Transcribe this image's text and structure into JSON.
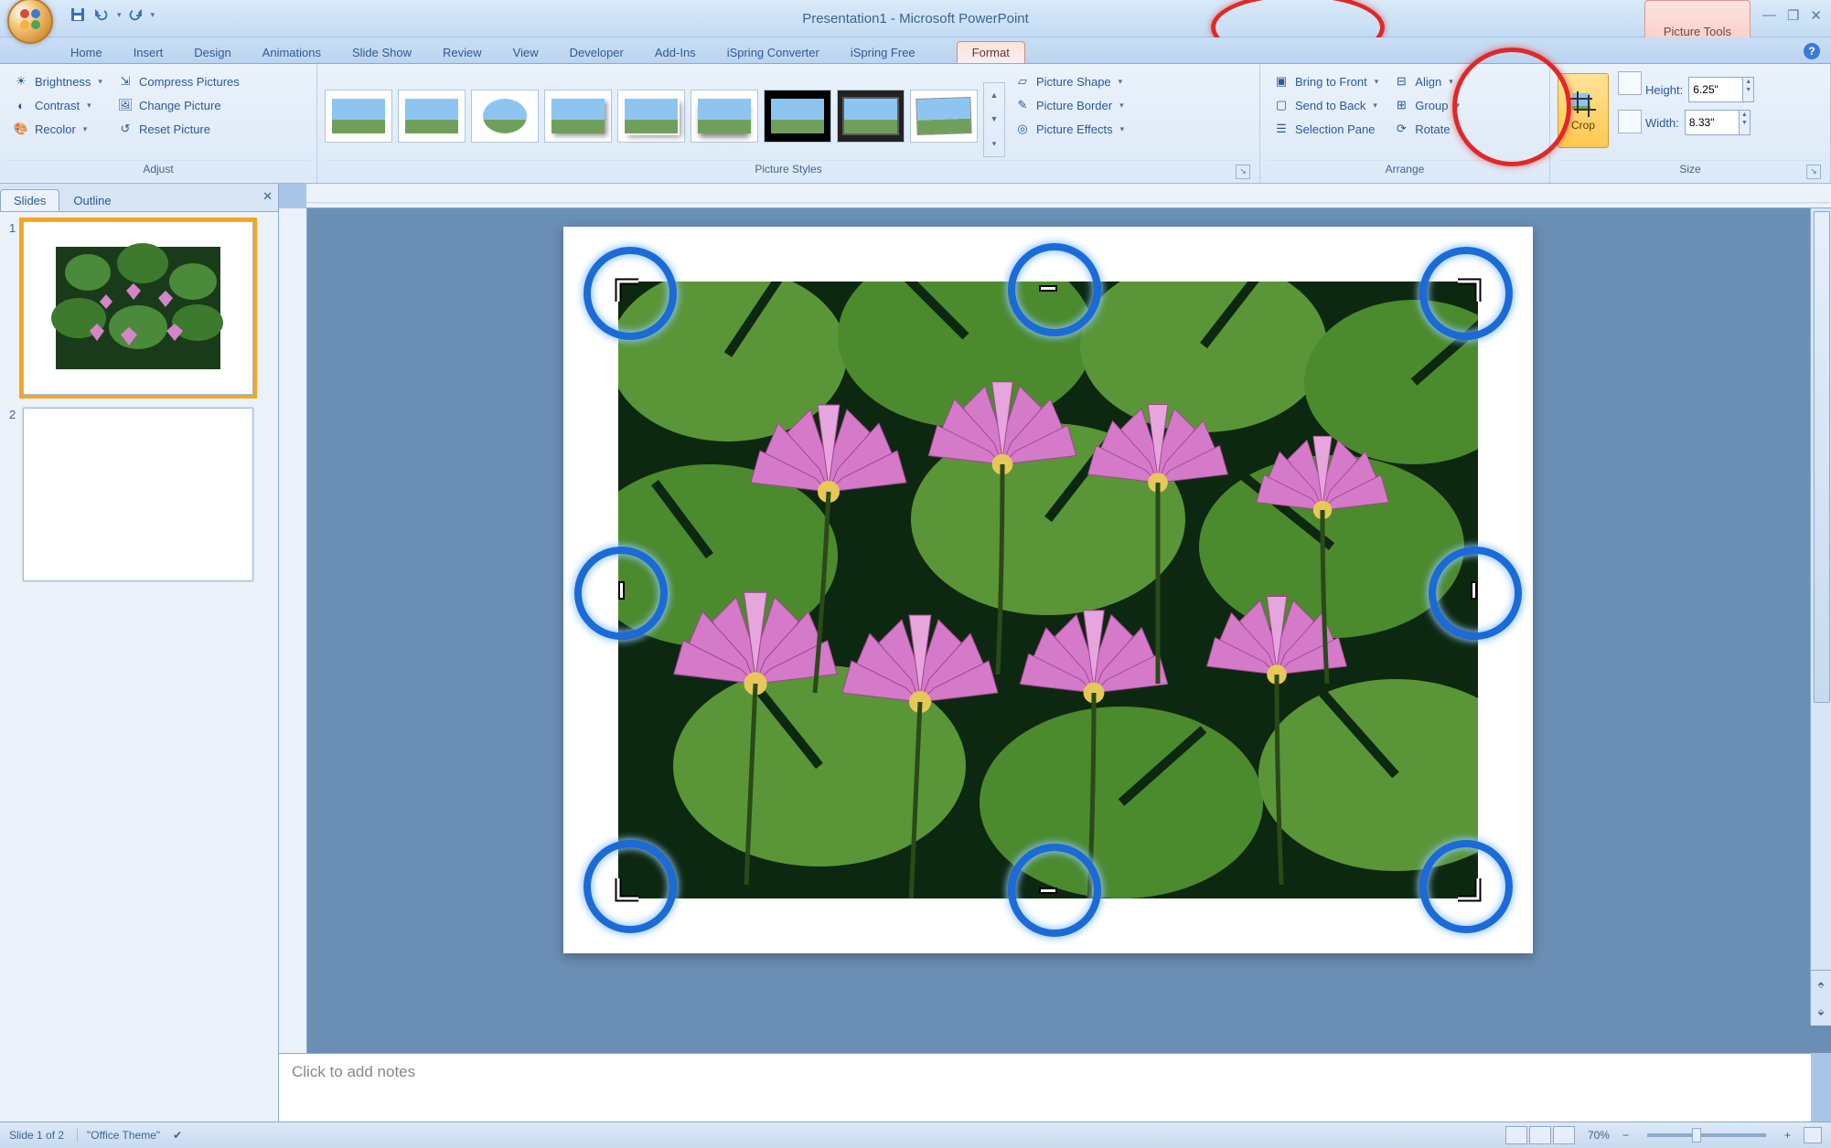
{
  "title": "Presentation1 - Microsoft PowerPoint",
  "contextual_tab_group": "Picture Tools",
  "tabs": {
    "home": "Home",
    "insert": "Insert",
    "design": "Design",
    "animations": "Animations",
    "slide_show": "Slide Show",
    "review": "Review",
    "view": "View",
    "developer": "Developer",
    "add_ins": "Add-Ins",
    "ispring_converter": "iSpring Converter",
    "ispring_free": "iSpring Free",
    "format": "Format"
  },
  "ribbon": {
    "adjust": {
      "label": "Adjust",
      "brightness": "Brightness",
      "contrast": "Contrast",
      "recolor": "Recolor",
      "compress": "Compress Pictures",
      "change": "Change Picture",
      "reset": "Reset Picture"
    },
    "picture_styles": {
      "label": "Picture Styles",
      "shape": "Picture Shape",
      "border": "Picture Border",
      "effects": "Picture Effects"
    },
    "arrange": {
      "label": "Arrange",
      "bring_front": "Bring to Front",
      "send_back": "Send to Back",
      "selection_pane": "Selection Pane",
      "align": "Align",
      "group": "Group",
      "rotate": "Rotate"
    },
    "size": {
      "label": "Size",
      "crop": "Crop",
      "height_label": "Height:",
      "height_value": "6.25\"",
      "width_label": "Width:",
      "width_value": "8.33\""
    }
  },
  "panel": {
    "slides": "Slides",
    "outline": "Outline",
    "n1": "1",
    "n2": "2"
  },
  "notes_placeholder": "Click to add notes",
  "status": {
    "slide": "Slide 1 of 2",
    "theme": "\"Office Theme\"",
    "zoom": "70%"
  }
}
